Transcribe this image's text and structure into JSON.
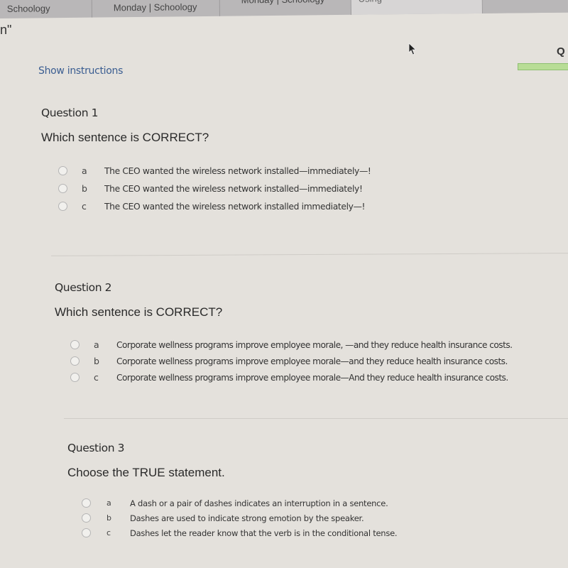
{
  "browser": {
    "tabs": [
      {
        "label": "Schoology"
      },
      {
        "label": "Monday | Schoology"
      },
      {
        "label": "Monday | Schoology"
      },
      {
        "label": "Using"
      },
      {
        "label": ""
      }
    ]
  },
  "page": {
    "title_fragment": "n\"",
    "show_instructions_label": "Show instructions",
    "header_fragment": "Q",
    "progress_percent": 100,
    "progress_color": "#b8dd96"
  },
  "questions": [
    {
      "title": "Question 1",
      "prompt": "Which sentence is CORRECT?",
      "options": [
        {
          "letter": "a",
          "text": "The CEO wanted the wireless network installed—immediately—!",
          "selected": false
        },
        {
          "letter": "b",
          "text": "The CEO wanted the wireless network installed—immediately!",
          "selected": false
        },
        {
          "letter": "c",
          "text": "The CEO wanted the wireless network installed immediately—!",
          "selected": false
        }
      ]
    },
    {
      "title": "Question 2",
      "prompt": "Which sentence is CORRECT?",
      "options": [
        {
          "letter": "a",
          "text": "Corporate wellness programs improve employee morale, —and they reduce health insurance costs.",
          "selected": false
        },
        {
          "letter": "b",
          "text": "Corporate wellness programs improve employee morale—and they reduce health insurance costs.",
          "selected": false
        },
        {
          "letter": "c",
          "text": "Corporate wellness programs improve employee morale—And they reduce health insurance costs.",
          "selected": false
        }
      ]
    },
    {
      "title": "Question 3",
      "prompt": "Choose the TRUE statement.",
      "options": [
        {
          "letter": "a",
          "text": "A dash or a pair of dashes indicates an interruption in a sentence.",
          "selected": false
        },
        {
          "letter": "b",
          "text": "Dashes are used to indicate strong emotion by the speaker.",
          "selected": false
        },
        {
          "letter": "c",
          "text": "Dashes let the reader know that the verb is in the conditional tense.",
          "selected": false
        }
      ]
    }
  ]
}
